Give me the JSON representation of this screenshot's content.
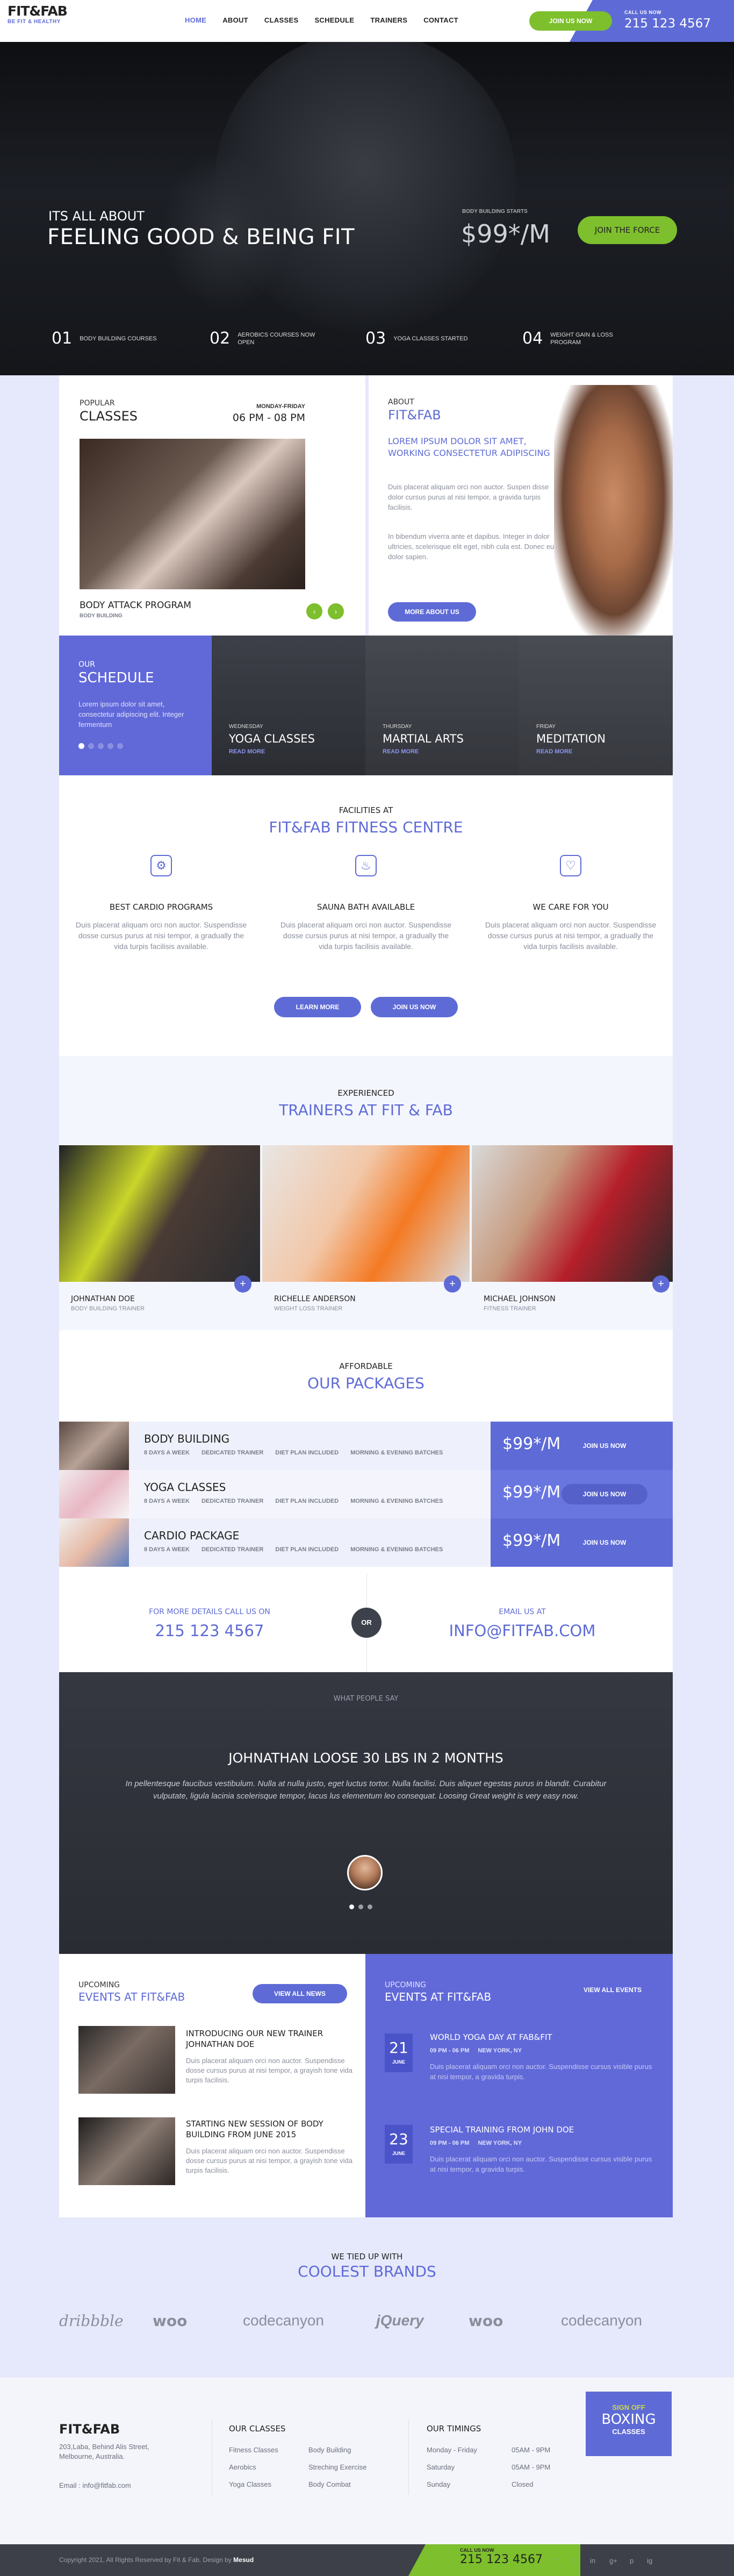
{
  "header": {
    "logo": "FIT&FAB",
    "tagline": "BE FIT & HEALTHY",
    "nav": [
      "HOME",
      "ABOUT",
      "CLASSES",
      "SCHEDULE",
      "TRAINERS",
      "CONTACT"
    ],
    "join_label": "JOIN US NOW",
    "call_label": "CALL US NOW",
    "call_number": "215 123 4567"
  },
  "hero": {
    "line1": "ITS ALL ABOUT",
    "line2": "FEELING GOOD & BEING FIT",
    "price_label": "BODY BUILDING STARTS",
    "price": "$99*/M",
    "button": "JOIN THE FORCE",
    "features": [
      {
        "num": "01",
        "label": "BODY BUILDING COURSES"
      },
      {
        "num": "02",
        "label": "AEROBICS COURSES NOW OPEN"
      },
      {
        "num": "03",
        "label": "YOGA CLASSES STARTED"
      },
      {
        "num": "04",
        "label": "WEIGHT GAIN & LOSS PROGRAM"
      }
    ]
  },
  "popular": {
    "small": "POPULAR",
    "big": "CLASSES",
    "day": "MONDAY-FRIDAY",
    "time": "06 PM - 08 PM",
    "program": "BODY ATTACK PROGRAM",
    "program_sub": "BODY BUILDING"
  },
  "about": {
    "small": "ABOUT",
    "big": "FIT&FAB",
    "lead": "LOREM IPSUM DOLOR SIT AMET, WORKING CONSECTETUR ADIPISCING",
    "p1": "Duis placerat aliquam orci non auctor. Suspen disse dolor cursus purus at nisi tempor, a gravida turpis facilisis.",
    "p2": "In bibendum viverra ante et dapibus. Integer in dolor ultricies, scelerisque elit eget, nibh cula est. Donec eu dolor sapien.",
    "button": "MORE ABOUT US"
  },
  "schedule": {
    "small": "OUR",
    "big": "SCHEDULE",
    "text": "Lorem ipsum dolor sit amet, consectetur adipiscing elit. Integer fermentum",
    "items": [
      {
        "day": "WEDNESDAY",
        "name": "YOGA CLASSES",
        "link": "READ MORE"
      },
      {
        "day": "THURSDAY",
        "name": "MARTIAL ARTS",
        "link": "READ MORE"
      },
      {
        "day": "FRIDAY",
        "name": "MEDITATION",
        "link": "READ MORE"
      }
    ]
  },
  "facilities": {
    "small": "FACILITIES AT",
    "big": "FIT&FAB FITNESS CENTRE",
    "items": [
      {
        "title": "BEST CARDIO PROGRAMS",
        "text": "Duis placerat aliquam orci non auctor. Suspendisse dosse cursus purus at nisi tempor, a gradually the vida turpis facilisis available."
      },
      {
        "title": "SAUNA BATH AVAILABLE",
        "text": "Duis placerat aliquam orci non auctor. Suspendisse dosse cursus purus at nisi tempor, a gradually the vida turpis facilisis available."
      },
      {
        "title": "WE CARE FOR YOU",
        "text": "Duis placerat aliquam orci non auctor. Suspendisse dosse cursus purus at nisi tempor, a gradually the vida turpis facilisis available."
      }
    ],
    "btn1": "LEARN MORE",
    "btn2": "JOIN US NOW"
  },
  "trainers": {
    "small": "EXPERIENCED",
    "big": "TRAINERS AT FIT & FAB",
    "items": [
      {
        "name": "JOHNATHAN DOE",
        "role": "BODY BUILDING TRAINER"
      },
      {
        "name": "RICHELLE ANDERSON",
        "role": "WEIGHT LOSS TRAINER"
      },
      {
        "name": "MICHAEL JOHNSON",
        "role": "FITNESS TRAINER"
      }
    ]
  },
  "packages": {
    "small": "AFFORDABLE",
    "big": "OUR PACKAGES",
    "tags": [
      "8 DAYS A WEEK",
      "DEDICATED TRAINER",
      "DIET PLAN INCLUDED",
      "MORNING & EVENING BATCHES"
    ],
    "items": [
      {
        "name": "BODY BUILDING",
        "price": "$99*/M",
        "button": "JOIN US NOW"
      },
      {
        "name": "YOGA CLASSES",
        "price": "$99*/M",
        "button": "JOIN US NOW"
      },
      {
        "name": "CARDIO PACKAGE",
        "price": "$99*/M",
        "button": "JOIN US NOW"
      }
    ],
    "call_label": "FOR MORE DETAILS CALL US ON",
    "call_value": "215 123 4567",
    "or": "OR",
    "email_label": "EMAIL US AT",
    "email_value": "INFO@FITFAB.COM"
  },
  "testimonial": {
    "small": "WHAT PEOPLE SAY",
    "title": "JOHNATHAN LOOSE 30 LBS IN 2 MONTHS",
    "text": "In pellentesque faucibus vestibulum. Nulla at nulla justo, eget luctus tortor. Nulla facilisi. Duis aliquet egestas purus in blandit. Curabitur vulputate, ligula lacinia scelerisque tempor, lacus lus elementum leo consequat. Loosing Great weight is very easy now."
  },
  "events_left": {
    "small": "UPCOMING",
    "big": "EVENTS AT FIT&FAB",
    "button": "VIEW ALL NEWS",
    "items": [
      {
        "title": "INTRODUCING OUR NEW TRAINER JOHNATHAN DOE",
        "text": "Duis placerat aliquam orci non auctor. Suspendisse dosse cursus purus at nisi tempor, a grayish tone vida turpis facilisis."
      },
      {
        "title": "STARTING NEW SESSION OF BODY BUILDING FROM JUNE 2015",
        "text": "Duis placerat aliquam orci non auctor. Suspendisse dosse cursus purus at nisi tempor, a grayish tone vida turpis facilisis."
      }
    ]
  },
  "events_right": {
    "small": "UPCOMING",
    "big": "EVENTS AT FIT&FAB",
    "button": "VIEW ALL EVENTS",
    "items": [
      {
        "day": "21",
        "month": "JUNE",
        "title": "WORLD YOGA DAY AT FAB&FIT",
        "time": "09 PM - 06 PM",
        "place": "NEW YORK, NY",
        "text": "Duis placerat aliquam orci non auctor. Suspendisse cursus visible purus at nisi tempor, a gravida turpis."
      },
      {
        "day": "23",
        "month": "JUNE",
        "title": "SPECIAL TRAINING FROM JOHN DOE",
        "time": "09 PM - 06 PM",
        "place": "NEW YORK, NY",
        "text": "Duis placerat aliquam orci non auctor. Suspendisse cursus visible purus at nisi tempor, a gravida turpis."
      }
    ]
  },
  "brands": {
    "small": "WE TIED UP WITH",
    "big": "COOLEST BRANDS",
    "items": [
      "dribbble",
      "woo",
      "codecanyon",
      "jQuery",
      "woo",
      "codecanyon"
    ]
  },
  "footer": {
    "logo": "FIT&FAB",
    "address": "203,Laba, Behind Alis Street, Melbourne, Australia.",
    "email": "Email : info@fitfab.com",
    "classes_title": "OUR CLASSES",
    "classes": [
      "Fitness Classes",
      "Body Building",
      "Aerobics",
      "Streching Exercise",
      "Yoga Classes",
      "Body Combat"
    ],
    "timings_title": "OUR TIMINGS",
    "timings": [
      {
        "day": "Monday - Friday",
        "time": "05AM - 9PM"
      },
      {
        "day": "Saturday",
        "time": "05AM - 9PM"
      },
      {
        "day": "Sunday",
        "time": "Closed"
      }
    ],
    "promo_small": "SIGN OFF",
    "promo_big": "BOXING",
    "promo_sub": "CLASSES",
    "copyright": "Copyright 2021, All Rights Reserved by Fit & Fab. Design by",
    "designer": "Mesud",
    "call_label": "CALL US NOW",
    "call_number": "215 123 4567",
    "social": [
      "f",
      "t",
      "in",
      "g+",
      "p",
      "ig"
    ]
  }
}
